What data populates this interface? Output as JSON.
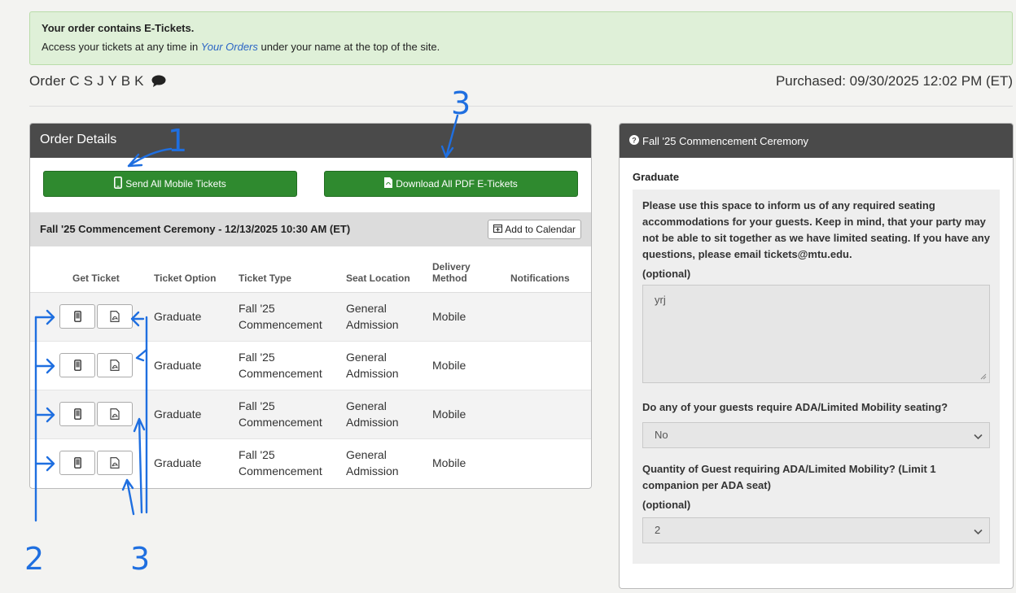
{
  "alert": {
    "title": "Your order contains E-Tickets.",
    "text_before": "Access your tickets at any time in ",
    "link": "Your Orders",
    "text_after": " under your name at the top of the site."
  },
  "order": {
    "label": "Order C S J Y B K",
    "purchased": "Purchased: 09/30/2025 12:02 PM (ET)"
  },
  "details": {
    "title": "Order Details",
    "send_all": "Send All Mobile Tickets",
    "download_all": "Download All PDF E-Tickets",
    "event_title": "Fall '25 Commencement Ceremony - 12/13/2025 10:30 AM (ET)",
    "add_calendar": "Add to Calendar",
    "columns": {
      "get_ticket": "Get Ticket",
      "ticket_option": "Ticket Option",
      "ticket_type": "Ticket Type",
      "seat_location": "Seat Location",
      "delivery_1": "Delivery",
      "delivery_2": "Method",
      "notifications": "Notifications"
    },
    "rows": [
      {
        "option": "Graduate",
        "type_1": "Fall '25",
        "type_2": "Commencement",
        "seat_1": "General",
        "seat_2": "Admission",
        "delivery": "Mobile"
      },
      {
        "option": "Graduate",
        "type_1": "Fall '25",
        "type_2": "Commencement",
        "seat_1": "General",
        "seat_2": "Admission",
        "delivery": "Mobile"
      },
      {
        "option": "Graduate",
        "type_1": "Fall '25",
        "type_2": "Commencement",
        "seat_1": "General",
        "seat_2": "Admission",
        "delivery": "Mobile"
      },
      {
        "option": "Graduate",
        "type_1": "Fall '25",
        "type_2": "Commencement",
        "seat_1": "General",
        "seat_2": "Admission",
        "delivery": "Mobile"
      }
    ]
  },
  "info": {
    "title": "Fall '25 Commencement Ceremony",
    "graduate": "Graduate",
    "note": "Please use this space to inform us of any required seating accommodations for your guests. Keep in mind, that your party may not be able to sit together as we have limited seating. If you have any questions, please email tickets@mtu.edu.",
    "optional_1": "(optional)",
    "text_value": "yrj",
    "ada_question": "Do any of your guests require ADA/Limited Mobility seating?",
    "ada_value": "No",
    "qty_question": "Quantity of Guest requiring ADA/Limited Mobility? (Limit 1 companion per ADA seat)",
    "optional_2": "(optional)",
    "qty_value": "2"
  },
  "annotations": {
    "label_1": "1",
    "label_2": "2",
    "label_3a": "3",
    "label_3b": "3"
  },
  "colors": {
    "green": "#2f8a2f",
    "alert_bg": "#dff0d8",
    "panel_head": "#4a4a4a",
    "annotation": "#1f6fe0"
  }
}
